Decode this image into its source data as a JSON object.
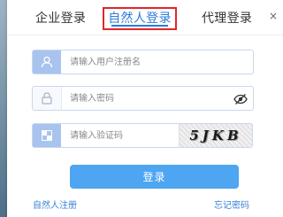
{
  "tabs": {
    "company": "企业登录",
    "natural": "自然人登录",
    "agent": "代理登录",
    "close": "×"
  },
  "form": {
    "username_placeholder": "请输入用户注册名",
    "password_placeholder": "请输入密码",
    "captcha_placeholder": "请输入验证码",
    "captcha_text": "5JKB"
  },
  "buttons": {
    "login": "登录"
  },
  "links": {
    "register": "自然人注册",
    "forgot": "忘记密码"
  },
  "icons": {
    "username": "user-icon",
    "password": "lock-icon",
    "captcha": "captcha-icon",
    "toggle": "eye-icon",
    "close": "close-icon"
  },
  "colors": {
    "accent": "#2d7cd8",
    "highlight_border": "#e0262a",
    "button": "#4ea5f2",
    "icon_box": "#a8c3ee"
  }
}
